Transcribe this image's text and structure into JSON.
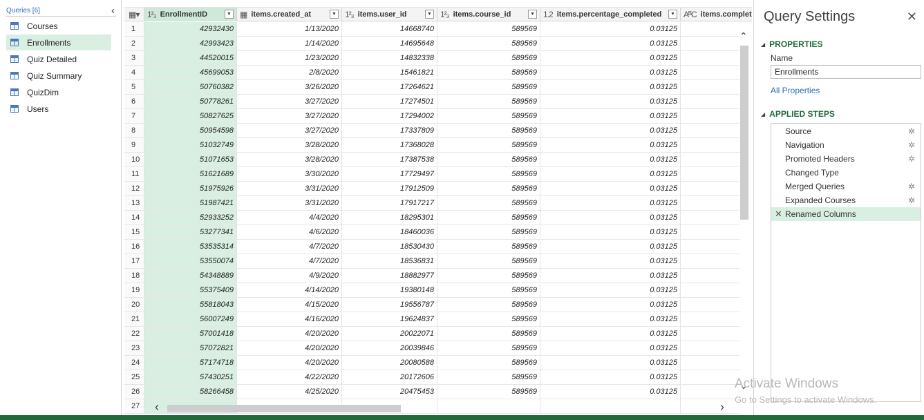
{
  "queries": {
    "header": "Queries [6]",
    "items": [
      {
        "label": "Courses"
      },
      {
        "label": "Enrollments",
        "selected": true
      },
      {
        "label": "Quiz Detailed"
      },
      {
        "label": "Quiz Summary"
      },
      {
        "label": "QuizDim"
      },
      {
        "label": "Users"
      }
    ]
  },
  "grid": {
    "columns": [
      {
        "type": "1²₃",
        "name": "EnrollmentID"
      },
      {
        "type": "date",
        "name": "items.created_at"
      },
      {
        "type": "1²₃",
        "name": "items.user_id"
      },
      {
        "type": "1²₃",
        "name": "items.course_id"
      },
      {
        "type": "1.2",
        "name": "items.percentage_completed"
      },
      {
        "type": "AᴮC",
        "name": "items.complete"
      }
    ],
    "rows": [
      {
        "n": "1",
        "id": "42932430",
        "created": "1/13/2020",
        "user": "14668740",
        "course": "589569",
        "pct": "0.03125"
      },
      {
        "n": "2",
        "id": "42993423",
        "created": "1/14/2020",
        "user": "14695648",
        "course": "589569",
        "pct": "0.03125"
      },
      {
        "n": "3",
        "id": "44520015",
        "created": "1/23/2020",
        "user": "14832338",
        "course": "589569",
        "pct": "0.03125"
      },
      {
        "n": "4",
        "id": "45699053",
        "created": "2/8/2020",
        "user": "15461821",
        "course": "589569",
        "pct": "0.03125"
      },
      {
        "n": "5",
        "id": "50760382",
        "created": "3/26/2020",
        "user": "17264621",
        "course": "589569",
        "pct": "0.03125"
      },
      {
        "n": "6",
        "id": "50778261",
        "created": "3/27/2020",
        "user": "17274501",
        "course": "589569",
        "pct": "0.03125"
      },
      {
        "n": "7",
        "id": "50827625",
        "created": "3/27/2020",
        "user": "17294002",
        "course": "589569",
        "pct": "0.03125"
      },
      {
        "n": "8",
        "id": "50954598",
        "created": "3/27/2020",
        "user": "17337809",
        "course": "589569",
        "pct": "0.03125"
      },
      {
        "n": "9",
        "id": "51032749",
        "created": "3/28/2020",
        "user": "17368028",
        "course": "589569",
        "pct": "0.03125"
      },
      {
        "n": "10",
        "id": "51071653",
        "created": "3/28/2020",
        "user": "17387538",
        "course": "589569",
        "pct": "0.03125"
      },
      {
        "n": "11",
        "id": "51621689",
        "created": "3/30/2020",
        "user": "17729497",
        "course": "589569",
        "pct": "0.03125"
      },
      {
        "n": "12",
        "id": "51975926",
        "created": "3/31/2020",
        "user": "17912509",
        "course": "589569",
        "pct": "0.03125"
      },
      {
        "n": "13",
        "id": "51987421",
        "created": "3/31/2020",
        "user": "17917217",
        "course": "589569",
        "pct": "0.03125"
      },
      {
        "n": "14",
        "id": "52933252",
        "created": "4/4/2020",
        "user": "18295301",
        "course": "589569",
        "pct": "0.03125"
      },
      {
        "n": "15",
        "id": "53277341",
        "created": "4/6/2020",
        "user": "18460036",
        "course": "589569",
        "pct": "0.03125"
      },
      {
        "n": "16",
        "id": "53535314",
        "created": "4/7/2020",
        "user": "18530430",
        "course": "589569",
        "pct": "0.03125"
      },
      {
        "n": "17",
        "id": "53550074",
        "created": "4/7/2020",
        "user": "18536831",
        "course": "589569",
        "pct": "0.03125"
      },
      {
        "n": "18",
        "id": "54348889",
        "created": "4/9/2020",
        "user": "18882977",
        "course": "589569",
        "pct": "0.03125"
      },
      {
        "n": "19",
        "id": "55375409",
        "created": "4/14/2020",
        "user": "19380148",
        "course": "589569",
        "pct": "0.03125"
      },
      {
        "n": "20",
        "id": "55818043",
        "created": "4/15/2020",
        "user": "19556787",
        "course": "589569",
        "pct": "0.03125"
      },
      {
        "n": "21",
        "id": "56007249",
        "created": "4/16/2020",
        "user": "19624837",
        "course": "589569",
        "pct": "0.03125"
      },
      {
        "n": "22",
        "id": "57001418",
        "created": "4/20/2020",
        "user": "20022071",
        "course": "589569",
        "pct": "0.03125"
      },
      {
        "n": "23",
        "id": "57072821",
        "created": "4/20/2020",
        "user": "20039846",
        "course": "589569",
        "pct": "0.03125"
      },
      {
        "n": "24",
        "id": "57174718",
        "created": "4/20/2020",
        "user": "20080588",
        "course": "589569",
        "pct": "0.03125"
      },
      {
        "n": "25",
        "id": "57430251",
        "created": "4/22/2020",
        "user": "20172606",
        "course": "589569",
        "pct": "0.03125"
      },
      {
        "n": "26",
        "id": "58266458",
        "created": "4/25/2020",
        "user": "20475453",
        "course": "589569",
        "pct": "0.03125"
      },
      {
        "n": "27",
        "id": "",
        "created": "",
        "user": "",
        "course": "",
        "pct": ""
      }
    ]
  },
  "settings": {
    "title": "Query Settings",
    "properties_heading": "PROPERTIES",
    "name_label": "Name",
    "name_value": "Enrollments",
    "all_properties": "All Properties",
    "steps_heading": "APPLIED STEPS",
    "steps": [
      {
        "label": "Source",
        "gear": true
      },
      {
        "label": "Navigation",
        "gear": true
      },
      {
        "label": "Promoted Headers",
        "gear": true
      },
      {
        "label": "Changed Type",
        "gear": false
      },
      {
        "label": "Merged Queries",
        "gear": true
      },
      {
        "label": "Expanded Courses",
        "gear": true
      },
      {
        "label": "Renamed Columns",
        "gear": false,
        "selected": true
      }
    ]
  },
  "watermark": {
    "line1": "Activate Windows",
    "line2": "Go to Settings to activate Windows."
  },
  "colors": {
    "accent_green": "#1e6b3d",
    "selection": "#d9efe2",
    "status_bar": "#1f6b3c"
  }
}
